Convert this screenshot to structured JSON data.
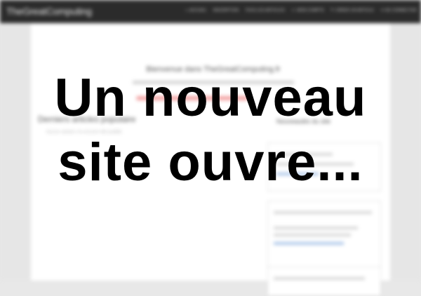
{
  "header": {
    "brand": "TheGreatComputing",
    "nav": [
      {
        "icon": "home-icon",
        "glyph": "⌂",
        "label": "ACCUEIL"
      },
      {
        "icon": "",
        "glyph": "",
        "label": "INSCRIPTION"
      },
      {
        "icon": "",
        "glyph": "",
        "label": "TOUS LES ARTICLES"
      },
      {
        "icon": "user-icon",
        "glyph": "☺",
        "label": "MON COMPTE"
      },
      {
        "icon": "pencil-icon",
        "glyph": "✎",
        "label": "CRÉER UN ARTICLE"
      },
      {
        "icon": "login-icon",
        "glyph": "⇥",
        "label": "SE CONNECTER"
      }
    ]
  },
  "main": {
    "welcome": "Bienvenue dans TheGreatComputing.fr",
    "popular_title": "Derniers articles populaire",
    "popular_subtitle": "Aucun article n'a encore été publié."
  },
  "sidebar": {
    "title": "Nouveautés du site"
  },
  "overlay": {
    "line1": "Un nouveau",
    "line2": "site ouvre..."
  }
}
